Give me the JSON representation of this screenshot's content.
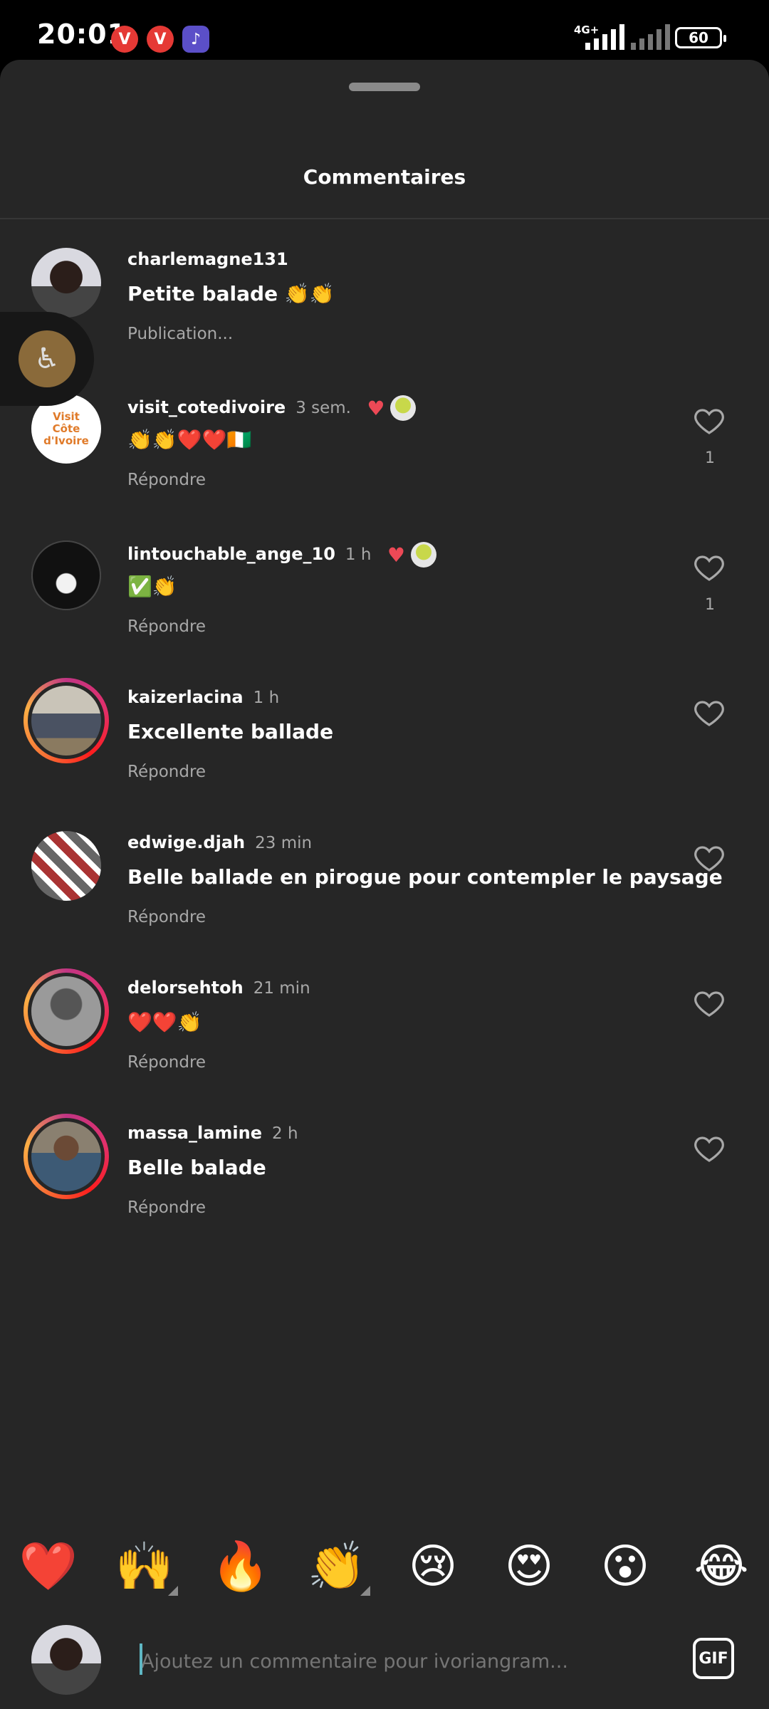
{
  "status_bar": {
    "time": "20:01",
    "network": "4G+",
    "battery": "60",
    "app_icons": [
      "vivaldi-icon",
      "vivaldi-icon",
      "music-icon"
    ]
  },
  "sheet": {
    "title": "Commentaires"
  },
  "comments": [
    {
      "username": "charlemagne131",
      "time": "",
      "text": "Petite balade 👏👏",
      "action": "Publication...",
      "likes": "",
      "liked_by_author": false
    },
    {
      "username": "visit_cotedivoire",
      "time": "3 sem.",
      "text": "👏👏❤️❤️🇨🇮",
      "action": "Répondre",
      "likes": "1",
      "liked_by_author": true
    },
    {
      "username": "lintouchable_ange_10",
      "time": "1 h",
      "text": "✅👏",
      "action": "Répondre",
      "likes": "1",
      "liked_by_author": true
    },
    {
      "username": "kaizerlacina",
      "time": "1 h",
      "text": "Excellente ballade",
      "action": "Répondre",
      "likes": "",
      "liked_by_author": false
    },
    {
      "username": "edwige.djah",
      "time": "23 min",
      "text": "Belle ballade en pirogue pour contempler le paysage",
      "action": "Répondre",
      "likes": "",
      "liked_by_author": false
    },
    {
      "username": "delorsehtoh",
      "time": "21 min",
      "text": "❤️❤️👏",
      "action": "Répondre",
      "likes": "",
      "liked_by_author": false
    },
    {
      "username": "massa_lamine",
      "time": "2 h",
      "text": "Belle balade",
      "action": "Répondre",
      "likes": "",
      "liked_by_author": false
    }
  ],
  "visit_logo": {
    "line1": "Visit",
    "line2": "Côte d'Ivoire"
  },
  "emoji_bar": [
    "❤️",
    "🙌",
    "🔥",
    "👏",
    "😢",
    "😍",
    "😮",
    "😂"
  ],
  "composer": {
    "placeholder": "Ajoutez un commentaire pour ivoriangram...",
    "gif_label": "GIF"
  },
  "colors": {
    "sheet_bg": "#262626",
    "secondary_text": "#a8a8a8",
    "heart_red": "#ed4956"
  }
}
